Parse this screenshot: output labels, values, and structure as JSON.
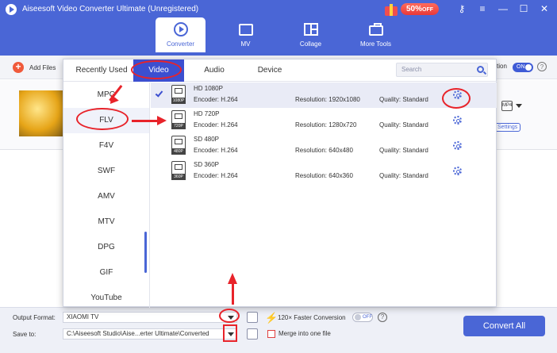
{
  "window": {
    "title": "Aiseesoft Video Converter Ultimate (Unregistered)",
    "promo": "50%",
    "promo_suffix": "OFF",
    "buttons": [
      "⚷",
      "≡",
      "—",
      "☐",
      "✕"
    ]
  },
  "nav": {
    "tabs": [
      {
        "label": "Converter",
        "active": true
      },
      {
        "label": "MV"
      },
      {
        "label": "Collage"
      },
      {
        "label": "More Tools"
      }
    ]
  },
  "toolbar": {
    "add_files": "Add Files",
    "notification_partial": "tion",
    "toggle_on": "ON"
  },
  "file_item": {
    "format_icon_label": "MP4",
    "settings_label": "Settings"
  },
  "format_panel": {
    "tabs": [
      {
        "label": "Recently Used"
      },
      {
        "label": "Video",
        "active": true
      },
      {
        "label": "Audio"
      },
      {
        "label": "Device"
      }
    ],
    "search_placeholder": "Search",
    "formats": [
      "MPG",
      "FLV",
      "F4V",
      "SWF",
      "AMV",
      "MTV",
      "DPG",
      "GIF",
      "YouTube"
    ],
    "selected_format": "FLV",
    "profiles": [
      {
        "tag": "1080P",
        "name": "HD 1080P",
        "encoder": "Encoder: H.264",
        "resolution": "Resolution: 1920x1080",
        "quality": "Quality: Standard",
        "selected": true
      },
      {
        "tag": "720P",
        "name": "HD 720P",
        "encoder": "Encoder: H.264",
        "resolution": "Resolution: 1280x720",
        "quality": "Quality: Standard"
      },
      {
        "tag": "480P",
        "name": "SD 480P",
        "encoder": "Encoder: H.264",
        "resolution": "Resolution: 640x480",
        "quality": "Quality: Standard"
      },
      {
        "tag": "360P",
        "name": "SD 360P",
        "encoder": "Encoder: H.264",
        "resolution": "Resolution: 640x360",
        "quality": "Quality: Standard"
      }
    ]
  },
  "bottom": {
    "output_format_label": "Output Format:",
    "output_format_value": "XIAOMI TV",
    "save_to_label": "Save to:",
    "save_to_value": "C:\\Aiseesoft Studio\\Aise...erter Ultimate\\Converted",
    "faster_label": "120× Faster Conversion",
    "faster_toggle": "OFF",
    "merge_label": "Merge into one file",
    "convert_all": "Convert All"
  },
  "colors": {
    "brand": "#4a66d6",
    "tab_active": "#3c4fd0",
    "annotation": "#e8232a",
    "promo": "#e8393a"
  }
}
